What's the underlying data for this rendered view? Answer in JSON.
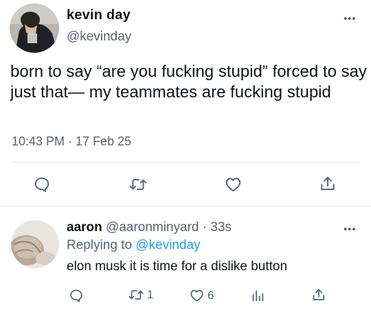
{
  "main_tweet": {
    "author_name": "kevin day",
    "handle": "@kevinday",
    "more_label": "•••",
    "text": "born to say “are you fucking stupid” forced to say just that— my teammates are fucking stupid",
    "timestamp": "10:43 PM · 17 Feb 25",
    "actions": [
      "reply-icon",
      "retweet-icon",
      "like-icon",
      "share-icon"
    ]
  },
  "reply": {
    "author_name": "aaron",
    "meta": " @aaronminyard · 33s",
    "replying_prefix": "Replying to ",
    "replying_to": "@kevinday",
    "more_label": "•••",
    "text": "elon musk it is time for a dislike button",
    "retweet_count": "1",
    "like_count": "6",
    "actions": [
      "reply-icon",
      "retweet-icon",
      "like-icon",
      "analytics-icon",
      "share-icon"
    ]
  },
  "colors": {
    "text": "#0f1419",
    "secondary": "#536471",
    "link": "#1d9bf0",
    "divider": "#e1e6ea"
  }
}
